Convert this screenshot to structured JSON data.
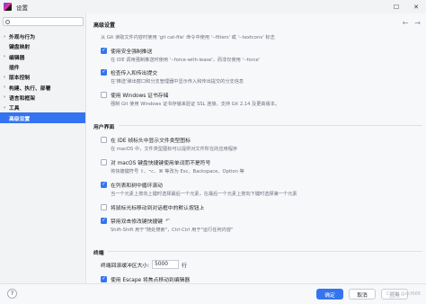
{
  "window": {
    "title": "设置"
  },
  "sidebar": {
    "search_placeholder": "",
    "items": [
      {
        "label": "外观与行为",
        "collapsed": true
      },
      {
        "label": "键盘映射",
        "collapsed": false
      },
      {
        "label": "编辑器",
        "collapsed": true
      },
      {
        "label": "插件",
        "collapsed": false
      },
      {
        "label": "版本控制",
        "collapsed": true
      },
      {
        "label": "构建、执行、部署",
        "collapsed": true
      },
      {
        "label": "语言和框架",
        "collapsed": true
      },
      {
        "label": "工具",
        "collapsed": true
      },
      {
        "label": "高级设置",
        "selected": true
      }
    ]
  },
  "main": {
    "breadcrumb": "高级设置",
    "git_section": {
      "intro": "从 Git 读取文件内容时使用 'git cat-file' 命令中使用 '--filters' 或 '--textconv' 标志",
      "opt_force_push_label": "使用安全强制推送",
      "opt_force_push_desc": "在 IDE 调用强制推送时使用 '--force-with-lease'，而非仅使用 '--force'",
      "opt_check_push_label": "检查传入和传出提交",
      "opt_check_push_desc": "在'推送'弹出窗口和分支管理器中显示传入和传出提交的分支信息",
      "opt_win_cert_label": "使用 Windows 证书存储",
      "opt_win_cert_desc": "强制 Git 使用 Windows 证书存储来验证 SSL 连接。支持 Git 2.14 及更高版本。"
    },
    "ui_section": {
      "title": "用户界面",
      "opt_filetype_icon_label": "在 IDE 帧标头中显示文件类型图标",
      "opt_filetype_icon_desc": "在 macOS 中，文件类型图标可以提供对文件所在的应用程序",
      "opt_macos_keys_label": "对 macOS 键盘快捷键使用单词而不是符号",
      "opt_macos_keys_desc": "将快捷键符号 ⇧、⌥、⌘ 等改为 Esc、Backspace、Option 等",
      "opt_cyclic_label": "在列表和树中循环滚动",
      "opt_cyclic_desc": "当一个元素上按向上键时选择最后一个元素，在最后一个元素上按向下键时选择第一个元素",
      "opt_move_mouse_label": "将鼠标光标移动到对话框中的默认按钮上",
      "opt_double_mod_label": "禁用双击修改键快捷键",
      "opt_double_mod_desc": "Shift-Shift 用于\"随处搜索\"，Ctrl-Ctrl 用于\"运行任何内容\""
    },
    "terminal_section": {
      "title": "终端",
      "buffer_label": "终端回滚缓冲区大小:",
      "buffer_value": "5000",
      "buffer_unit": "行",
      "opt_escape_label": "使用 Escape 将焦点移动到编辑器"
    }
  },
  "buttons": {
    "help": "?",
    "ok": "确定",
    "cancel": "取消",
    "apply": "应用"
  },
  "watermark": "CSDN @qcf666"
}
